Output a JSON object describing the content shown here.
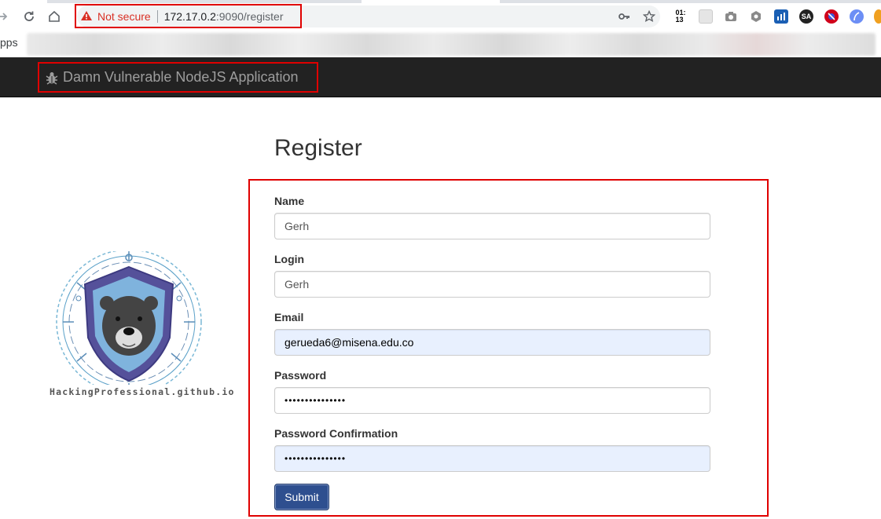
{
  "browser": {
    "security_label": "Not secure",
    "url_host": "172.17.0.2",
    "url_rest": ":9090/register",
    "bookmarks_apps_label": "pps",
    "extension_clock_text": "01:\n13",
    "extension_sa_text": "SA"
  },
  "navbar": {
    "brand": "Damn Vulnerable NodeJS Application"
  },
  "logo": {
    "caption": "HackingProfessional.github.io"
  },
  "page": {
    "title": "Register"
  },
  "form": {
    "name_label": "Name",
    "name_value": "Gerh",
    "login_label": "Login",
    "login_value": "Gerh",
    "email_label": "Email",
    "email_value": "gerueda6@misena.edu.co",
    "password_label": "Password",
    "password_value": "•••••••••••••••",
    "confirm_label": "Password Confirmation",
    "confirm_value": "•••••••••••••••",
    "submit_label": "Submit"
  },
  "colors": {
    "navbar_bg": "#222222",
    "brand_text": "#9d9d9d",
    "highlight_border": "#e00000",
    "submit_bg": "#2e4f8f",
    "autofill_bg": "#e8f0fe",
    "not_secure": "#d93025"
  },
  "icons": {
    "back": "arrow-right-icon",
    "reload": "reload-icon",
    "home": "home-icon",
    "warning": "warning-triangle-icon",
    "key": "key-icon",
    "star": "star-icon",
    "brand": "bug-icon"
  }
}
